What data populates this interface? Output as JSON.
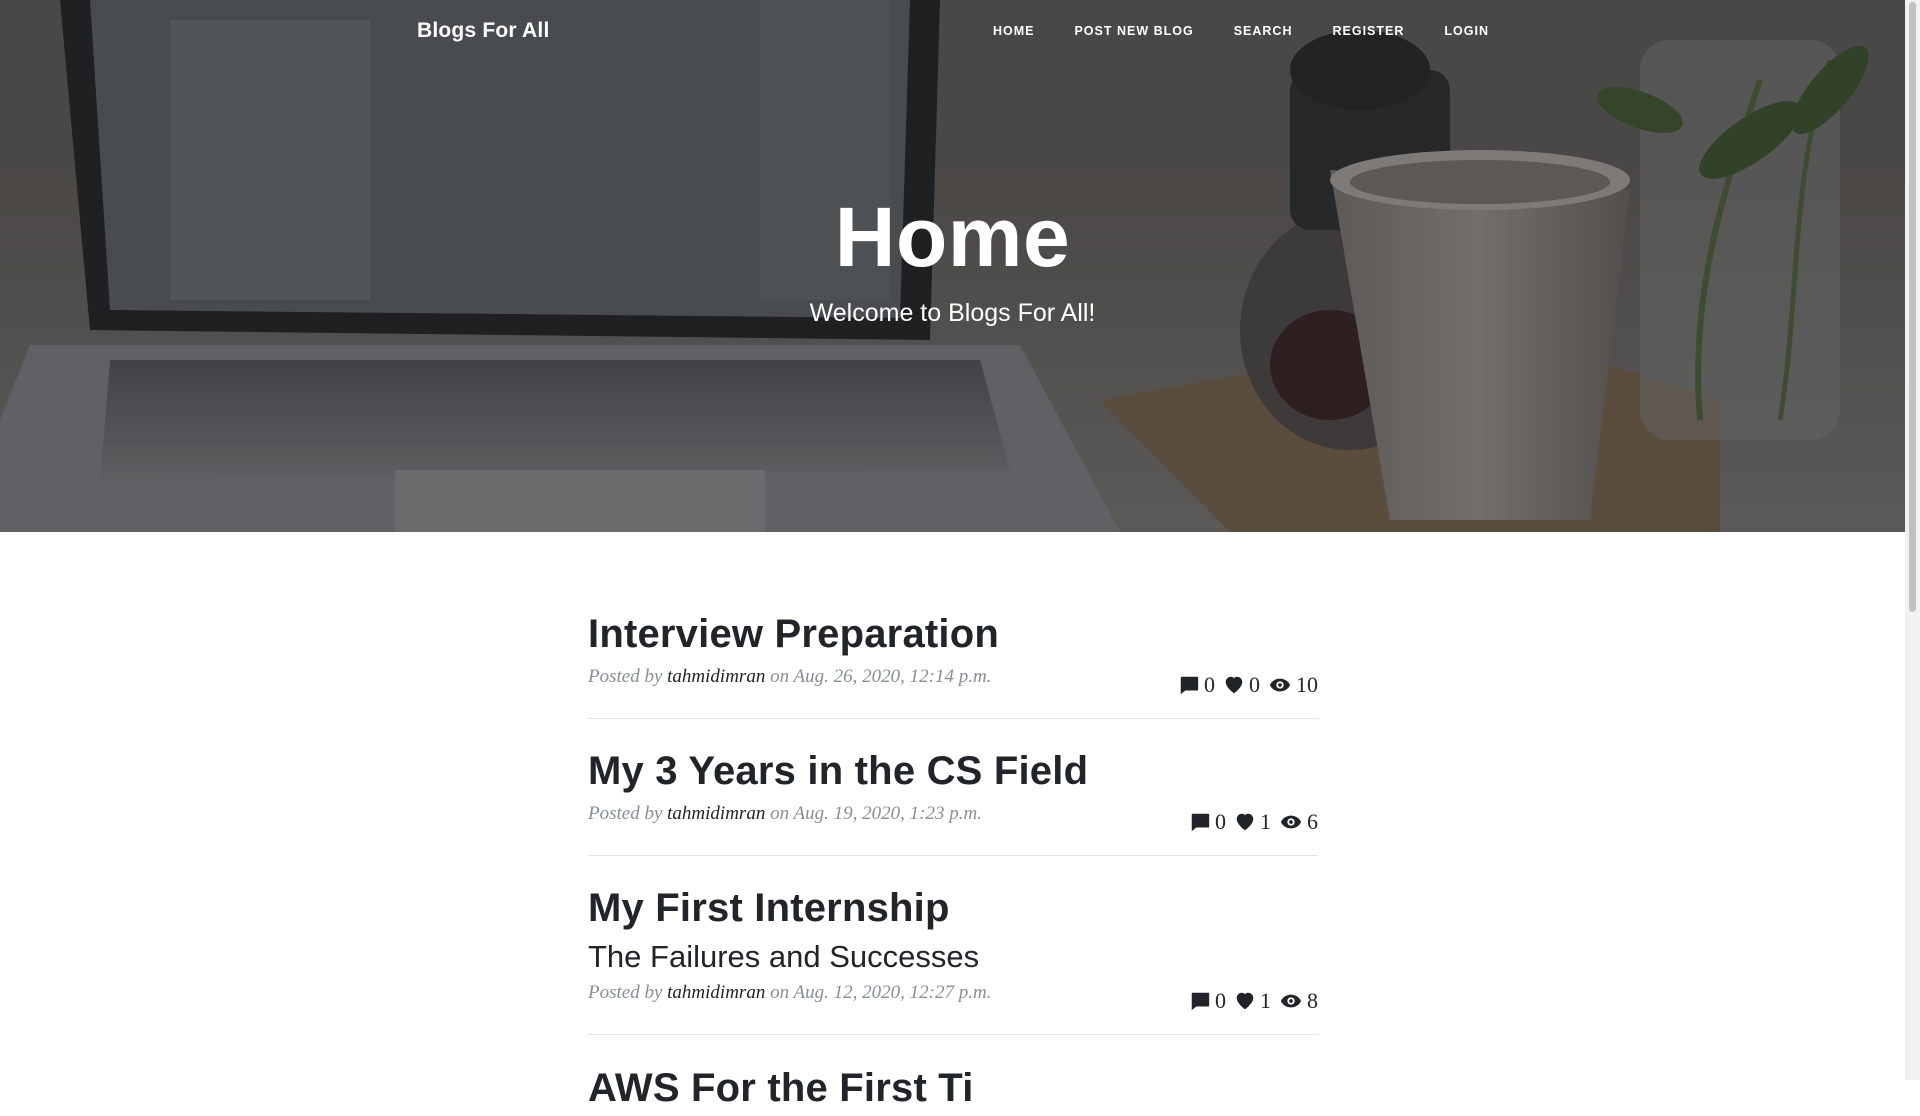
{
  "navbar": {
    "brand": "Blogs For All",
    "links": [
      "HOME",
      "POST NEW BLOG",
      "SEARCH",
      "REGISTER",
      "LOGIN"
    ]
  },
  "hero": {
    "title": "Home",
    "subtitle": "Welcome to Blogs For All!"
  },
  "posts": [
    {
      "title": "Interview Preparation",
      "subtitle": "",
      "posted_by": "Posted by",
      "author": "tahmidimran",
      "on": "on",
      "date": "Aug. 26, 2020, 12:14 p.m.",
      "comments": "0",
      "likes": "0",
      "views": "10"
    },
    {
      "title": "My 3 Years in the CS Field",
      "subtitle": "",
      "posted_by": "Posted by",
      "author": "tahmidimran",
      "on": "on",
      "date": "Aug. 19, 2020, 1:23 p.m.",
      "comments": "0",
      "likes": "1",
      "views": "6"
    },
    {
      "title": "My First Internship",
      "subtitle": "The Failures and Successes",
      "posted_by": "Posted by",
      "author": "tahmidimran",
      "on": "on",
      "date": "Aug. 12, 2020, 12:27 p.m.",
      "comments": "0",
      "likes": "1",
      "views": "8"
    },
    {
      "title": "AWS For the First Ti"
    }
  ],
  "icons": {
    "comment": "comment-icon",
    "like": "heart-icon",
    "views": "eye-icon"
  }
}
